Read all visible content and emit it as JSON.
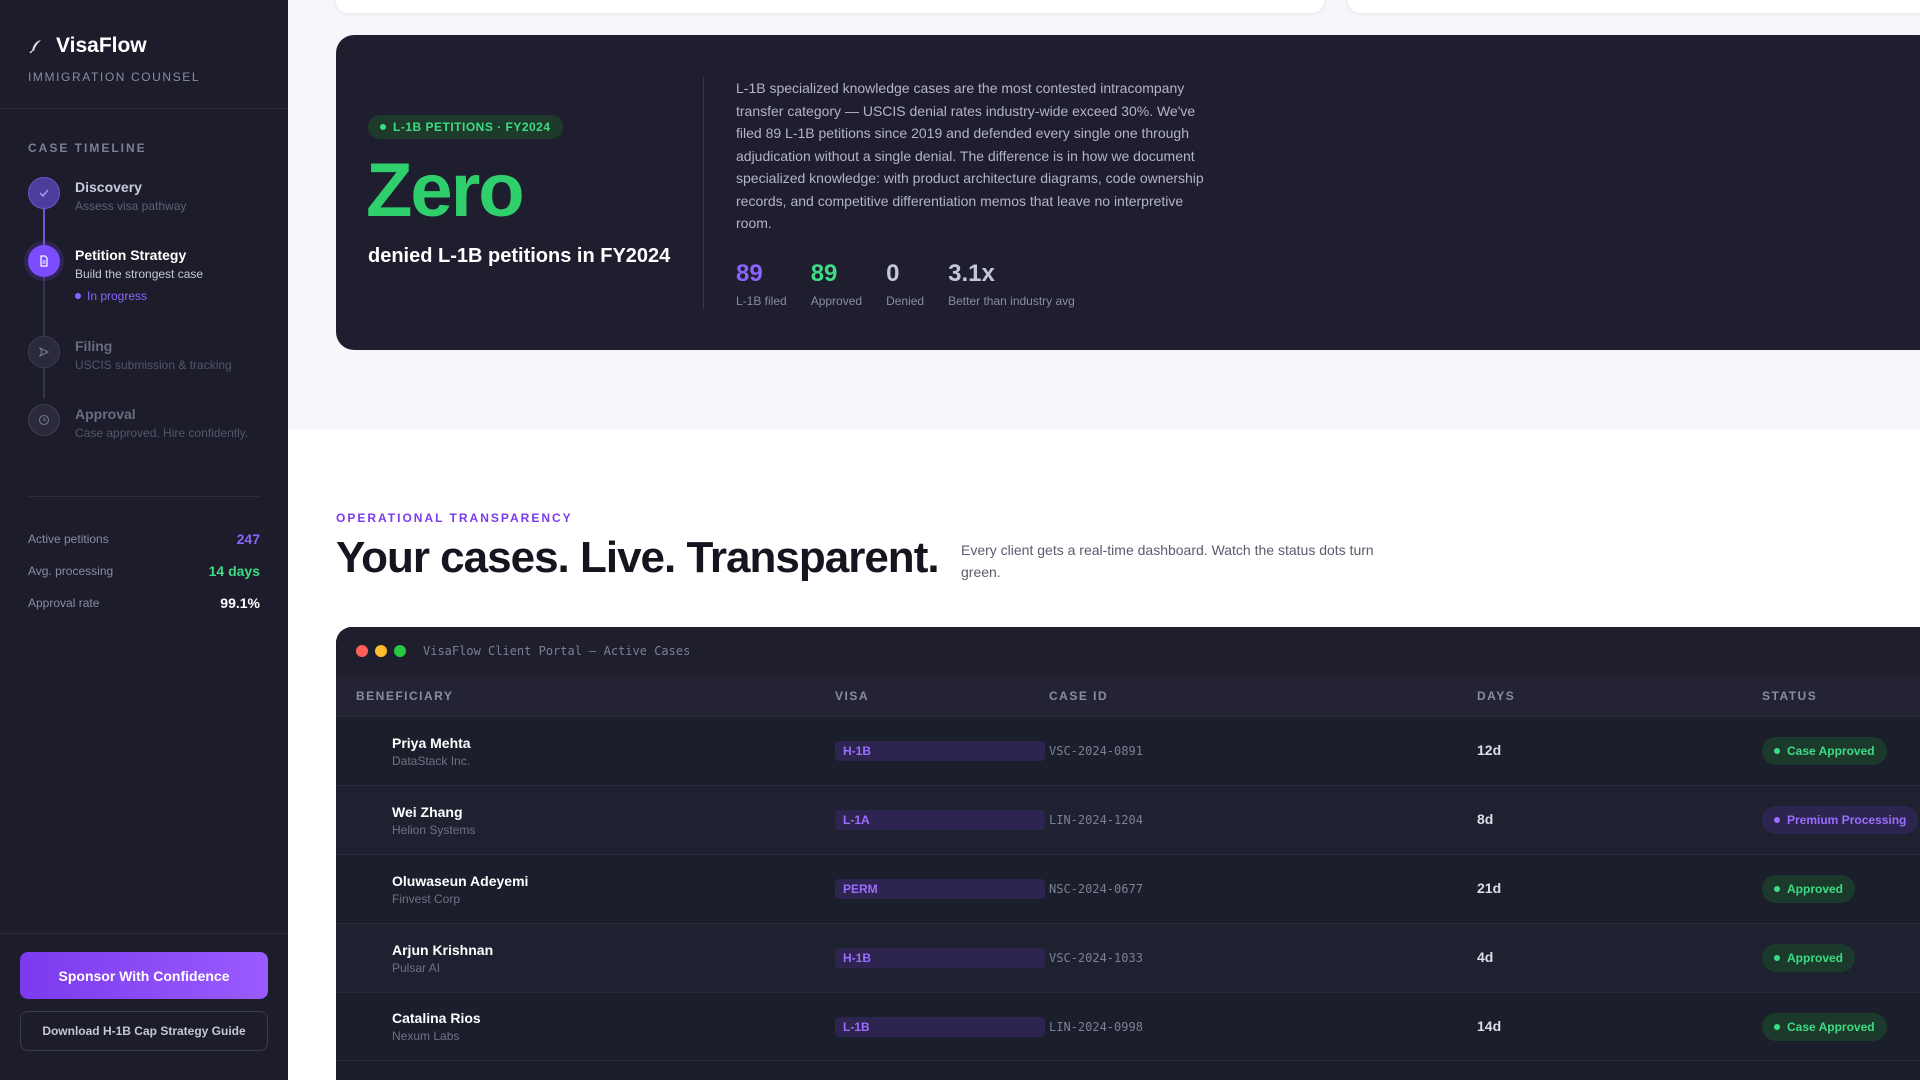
{
  "sidebar": {
    "brand": {
      "name": "VisaFlow",
      "subtitle": "IMMIGRATION COUNSEL"
    },
    "timeline_label": "CASE TIMELINE",
    "steps": [
      {
        "title": "Discovery",
        "desc": "Assess visa pathway",
        "state": "done",
        "icon": "check-icon"
      },
      {
        "title": "Petition Strategy",
        "desc": "Build the strongest case",
        "state": "active",
        "status": "In progress",
        "icon": "document-icon"
      },
      {
        "title": "Filing",
        "desc": "USCIS submission & tracking",
        "state": "pending",
        "icon": "send-icon"
      },
      {
        "title": "Approval",
        "desc": "Case approved. Hire confidently.",
        "state": "pending",
        "icon": "clock-icon"
      }
    ],
    "stats": [
      {
        "label": "Active petitions",
        "value": "247",
        "color": "#8b64ff"
      },
      {
        "label": "Avg. processing",
        "value": "14 days",
        "color": "#3ddc84"
      },
      {
        "label": "Approval rate",
        "value": "99.1%",
        "color": "#ffffff"
      }
    ],
    "cta_primary": "Sponsor With Confidence",
    "cta_secondary": "Download H-1B Cap Strategy Guide"
  },
  "hero": {
    "badge": "L-1B PETITIONS · FY2024",
    "big": "Zero",
    "sub": "denied L-1B petitions in FY2024",
    "paragraph": "L-1B specialized knowledge cases are the most contested intracompany transfer category — USCIS denial rates industry-wide exceed 30%. We've filed 89 L-1B petitions since 2019 and defended every single one through adjudication without a single denial. The difference is in how we document specialized knowledge: with product architecture diagrams, code ownership records, and competitive differentiation memos that leave no interpretive room.",
    "stats": [
      {
        "value": "89",
        "label": "L-1B filed",
        "color": "#8b64ff"
      },
      {
        "value": "89",
        "label": "Approved",
        "color": "#3ddc84"
      },
      {
        "value": "0",
        "label": "Denied",
        "color": "#c6c7d6"
      },
      {
        "value": "3.1x",
        "label": "Better than industry avg",
        "color": "#c6c7d6"
      }
    ]
  },
  "transparency": {
    "eyebrow": "OPERATIONAL TRANSPARENCY",
    "headline": "Your cases. Live. Transparent.",
    "description": "Every client gets a real-time dashboard. Watch the status dots turn green."
  },
  "portal": {
    "title": "VisaFlow Client Portal — Active Cases",
    "columns": [
      "BENEFICIARY",
      "VISA",
      "CASE ID",
      "DAYS",
      "STATUS"
    ],
    "rows": [
      {
        "name": "Priya Mehta",
        "company": "DataStack Inc.",
        "visa": "H-1B",
        "case_id": "VSC-2024-0891",
        "days": "12d",
        "status": "Case Approved",
        "tone": "green"
      },
      {
        "name": "Wei Zhang",
        "company": "Helion Systems",
        "visa": "L-1A",
        "case_id": "LIN-2024-1204",
        "days": "8d",
        "status": "Premium Processing",
        "tone": "purple"
      },
      {
        "name": "Oluwaseun Adeyemi",
        "company": "Finvest Corp",
        "visa": "PERM",
        "case_id": "NSC-2024-0677",
        "days": "21d",
        "status": "Approved",
        "tone": "green"
      },
      {
        "name": "Arjun Krishnan",
        "company": "Pulsar AI",
        "visa": "H-1B",
        "case_id": "VSC-2024-1033",
        "days": "4d",
        "status": "Approved",
        "tone": "green"
      },
      {
        "name": "Catalina Rios",
        "company": "Nexum Labs",
        "visa": "L-1B",
        "case_id": "LIN-2024-0998",
        "days": "14d",
        "status": "Case Approved",
        "tone": "green"
      }
    ]
  },
  "colors": {
    "accent": "#7c3aed",
    "success": "#3ddc84",
    "sidebar_bg": "#1c1c2b"
  }
}
